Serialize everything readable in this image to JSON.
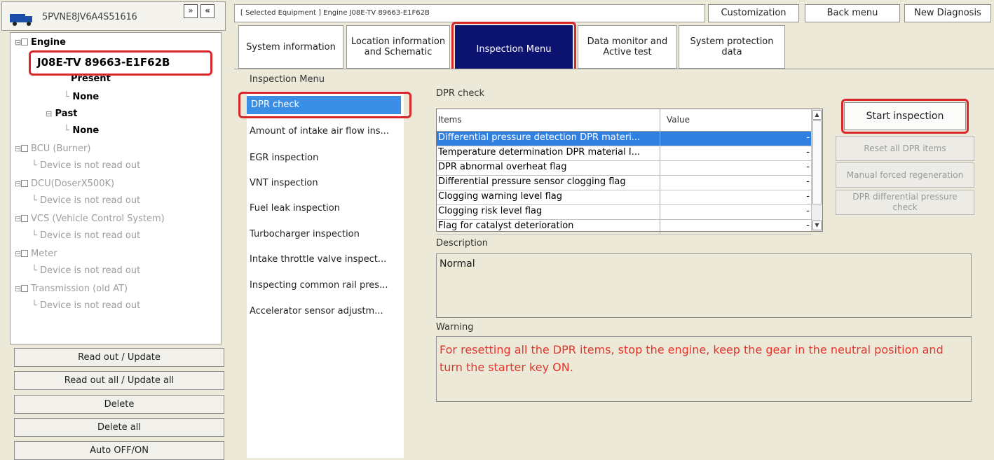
{
  "left": {
    "vin": "5PVNE8JV6A4S51616",
    "nav_btn1": "»",
    "nav_btn2": "«",
    "selected_equipment": "J08E-TV 89663-E1F62B",
    "tree": {
      "engine": "Engine",
      "present": "Present",
      "none1": "None",
      "past": "Past",
      "none2": "None",
      "bcu": "BCU (Burner)",
      "bcu_sub": "Device is not read out",
      "dcu": "DCU(DoserX500K)",
      "dcu_sub": "Device is not read out",
      "vcs": "VCS (Vehicle Control System)",
      "vcs_sub": "Device is not read out",
      "meter": "Meter",
      "meter_sub": "Device is not read out",
      "trans": "Transmission (old AT)",
      "trans_sub": "Device is not read out"
    },
    "buttons": {
      "read_update": "Read out / Update",
      "read_all": "Read out all / Update all",
      "delete": "Delete",
      "delete_all": "Delete all",
      "auto_off_on": "Auto OFF/ON"
    }
  },
  "header": {
    "selected_bar": "[ Selected Equipment ] Engine J08E-TV 89663-E1F62B",
    "customization": "Customization",
    "back_menu": "Back menu",
    "new_diagnosis": "New Diagnosis"
  },
  "tabs": {
    "system_info": "System information",
    "location": "Location information and Schematic",
    "inspection": "Inspection Menu",
    "data_monitor": "Data monitor and Active test",
    "system_protection": "System protection data"
  },
  "inspection": {
    "title": "Inspection Menu",
    "items": [
      "DPR check",
      "Amount of intake air flow ins...",
      "EGR inspection",
      "VNT inspection",
      "Fuel leak inspection",
      "Turbocharger inspection",
      "Intake throttle valve inspect...",
      "Inspecting common rail pres...",
      "Accelerator sensor adjustm..."
    ]
  },
  "dpr": {
    "title": "DPR check",
    "col_items": "Items",
    "col_value": "Value",
    "rows": [
      {
        "item": "Differential pressure detection DPR materi...",
        "value": "-"
      },
      {
        "item": "Temperature determination DPR material I...",
        "value": "-"
      },
      {
        "item": "DPR abnormal overheat flag",
        "value": "-"
      },
      {
        "item": "Differential pressure sensor clogging flag",
        "value": "-"
      },
      {
        "item": "Clogging warning level flag",
        "value": "-"
      },
      {
        "item": "Clogging risk level flag",
        "value": "-"
      },
      {
        "item": "Flag for catalyst deterioration",
        "value": "-"
      }
    ],
    "description_label": "Description",
    "description": "Normal",
    "warning_label": "Warning",
    "warning": "For resetting all the DPR items, stop the engine, keep the gear in the neutral position and turn the starter key ON.",
    "start_inspection": "Start inspection",
    "reset_all": "Reset all DPR items",
    "manual_regen": "Manual forced regeneration",
    "dpr_diff_check": "DPR differential pressure check"
  },
  "colors": {
    "highlight": "#d9262b",
    "active_tab": "#0c1270",
    "selection": "#3a8ee6",
    "warning_text": "#e5332a"
  }
}
